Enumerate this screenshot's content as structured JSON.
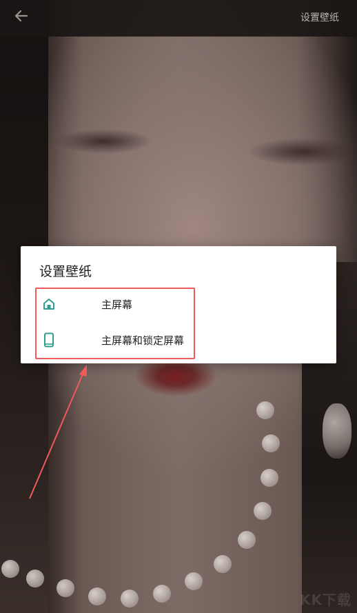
{
  "topbar": {
    "back_icon": "arrow-left-icon",
    "action_label": "设置壁纸"
  },
  "dialog": {
    "title": "设置壁纸",
    "options": [
      {
        "icon": "home-icon",
        "label": "主屏幕"
      },
      {
        "icon": "phone-icon",
        "label": "主屏幕和锁定屏幕"
      }
    ]
  },
  "colors": {
    "accent": "#2f9e8f",
    "annotation_red": "#f05a5a"
  },
  "watermark": "KK下载"
}
